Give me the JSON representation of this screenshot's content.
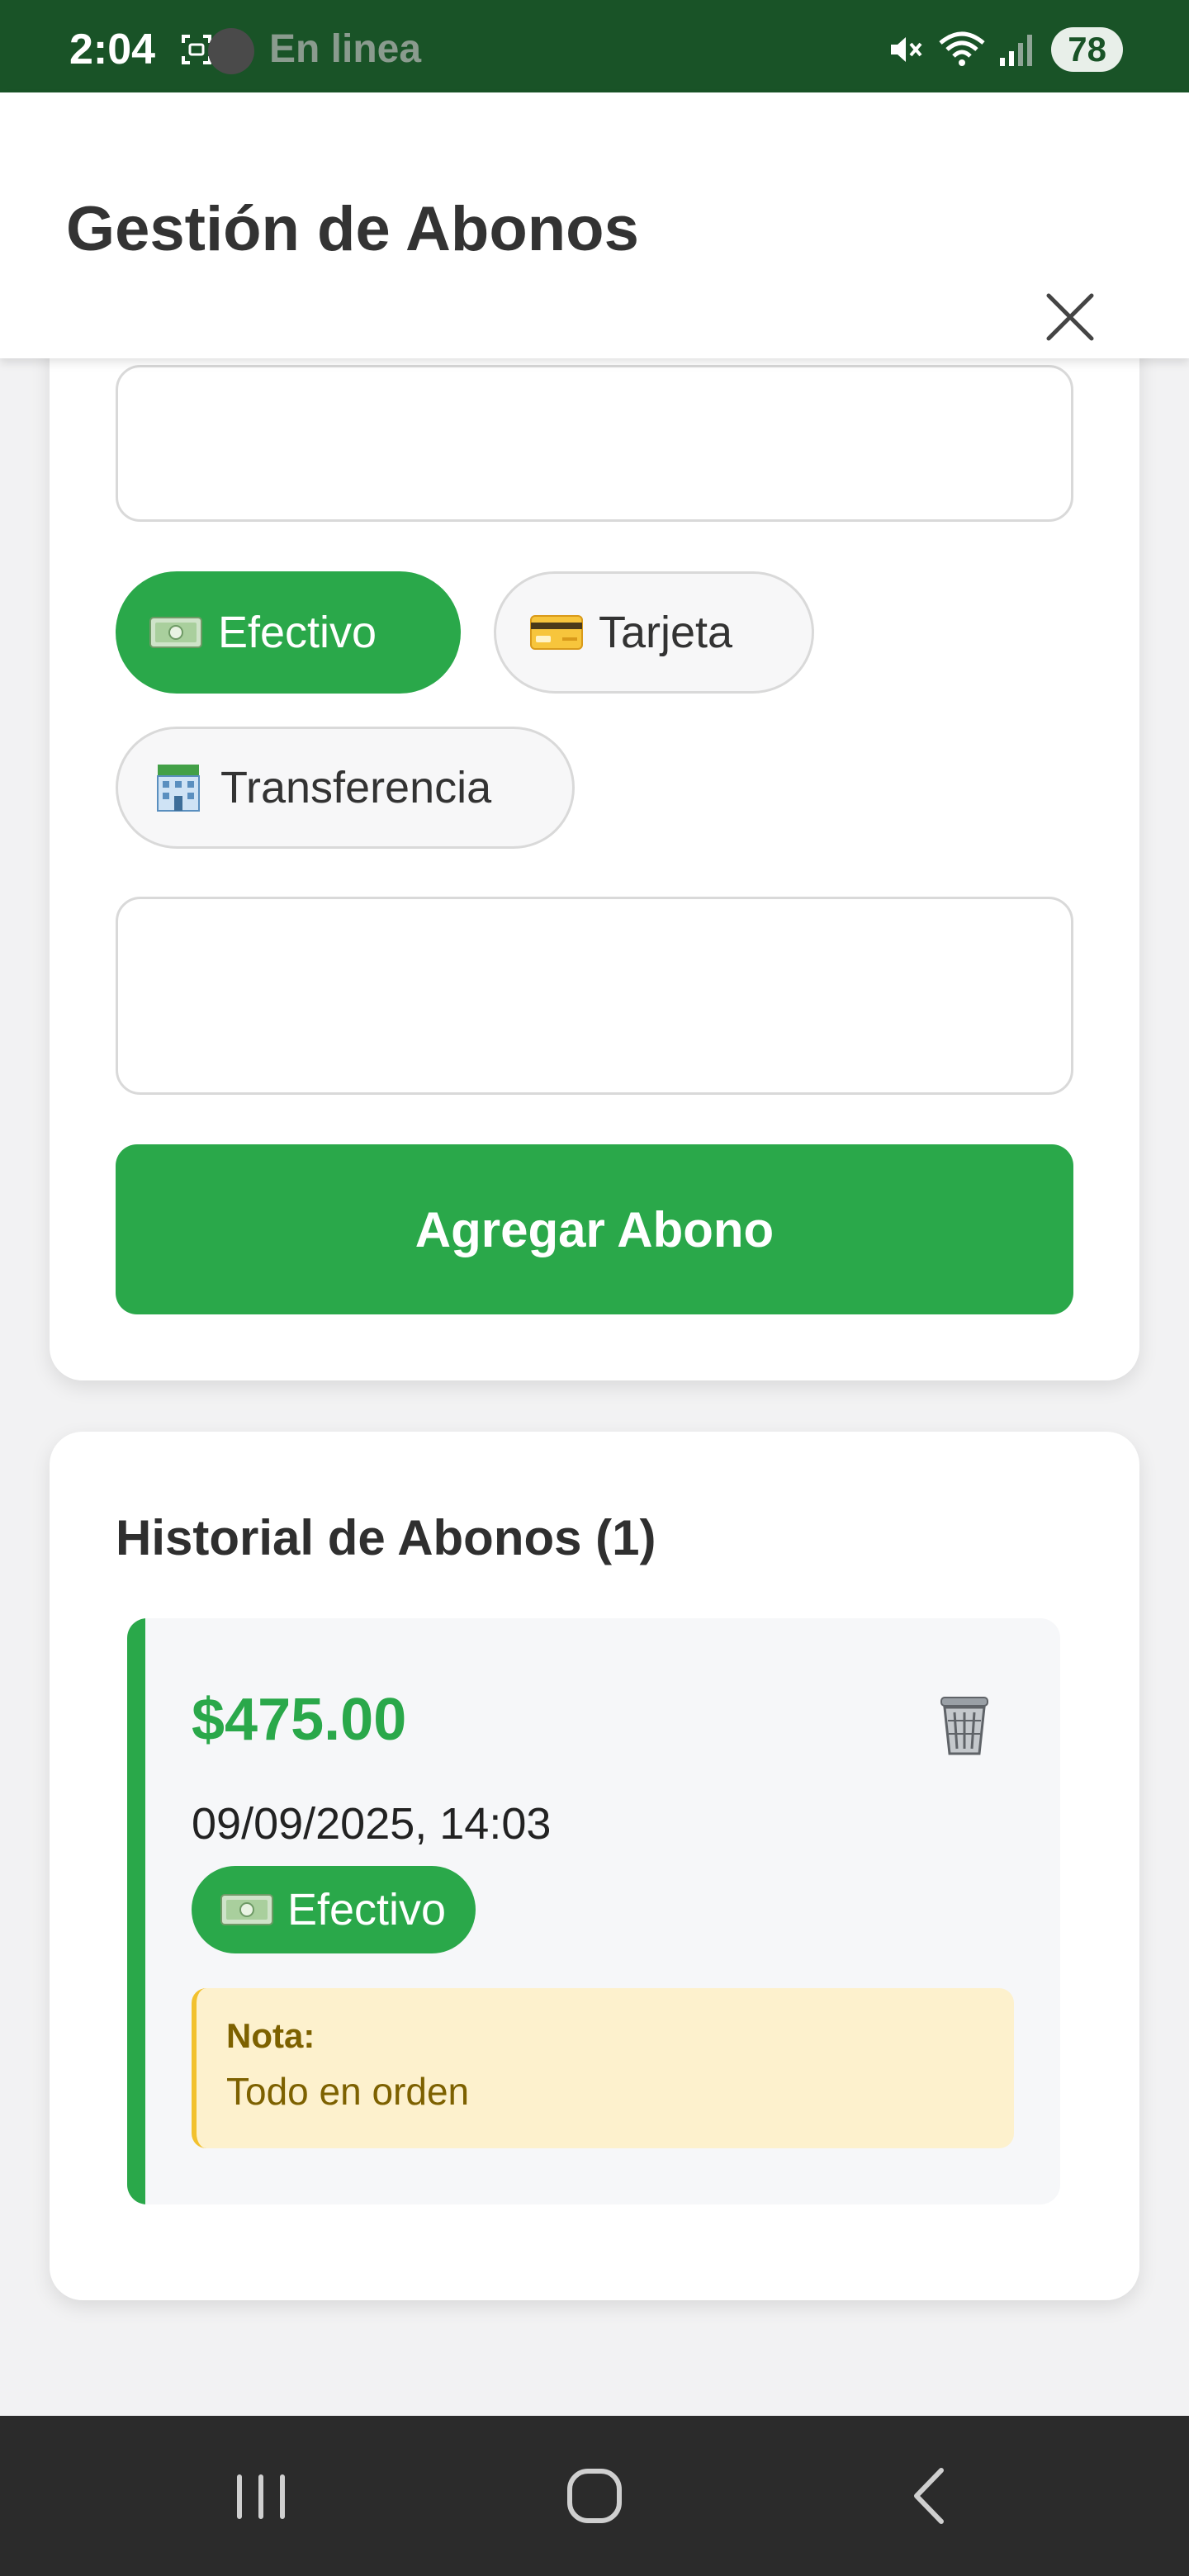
{
  "status_bar": {
    "time": "2:04",
    "online_text": "En linea",
    "battery": "78"
  },
  "header": {
    "title": "Gestión de Abonos",
    "close_icon": "close-icon"
  },
  "form": {
    "amount_value": "",
    "payment_methods": [
      {
        "label": "Efectivo",
        "icon": "cash-icon",
        "selected": true
      },
      {
        "label": "Tarjeta",
        "icon": "credit-card-icon",
        "selected": false
      },
      {
        "label": "Transferencia",
        "icon": "bank-icon",
        "selected": false
      }
    ],
    "note_value": "",
    "submit_label": "Agregar Abono"
  },
  "history": {
    "title": "Historial de Abonos (1)",
    "entries": [
      {
        "amount": "$475.00",
        "datetime": "09/09/2025, 14:03",
        "method": "Efectivo",
        "method_icon": "cash-icon",
        "note_label": "Nota:",
        "note": "Todo en orden",
        "delete_icon": "trash-icon"
      }
    ]
  },
  "colors": {
    "status_bar": "#195327",
    "accent_green": "#2aa84a",
    "note_background": "#fdf1cd",
    "note_border": "#f2c12e",
    "note_text": "#7d6100",
    "nav_bar": "#2b2b2b"
  }
}
